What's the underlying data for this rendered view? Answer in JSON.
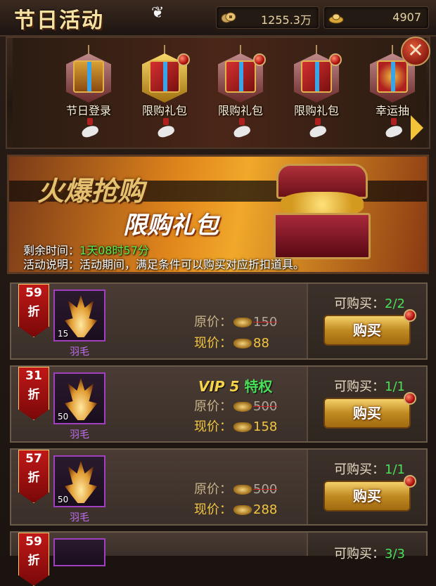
{
  "header": {
    "title": "节日活动",
    "currency_coin": "1255.3万",
    "currency_ingot": "4907"
  },
  "tabs": [
    {
      "label": "节日登录",
      "selected": false,
      "dot": false
    },
    {
      "label": "限购礼包",
      "selected": true,
      "dot": true
    },
    {
      "label": "限购礼包",
      "selected": false,
      "dot": true
    },
    {
      "label": "限购礼包",
      "selected": false,
      "dot": true
    },
    {
      "label": "幸运抽",
      "selected": false,
      "dot": true
    }
  ],
  "banner": {
    "headline": "火爆抢购",
    "subtitle": "限购礼包",
    "remaining_label": "剩余时间：",
    "remaining_value": "1天08时57分",
    "desc_label": "活动说明：",
    "desc_value": "活动期间，满足条件可以购买对应折扣道具。"
  },
  "items": [
    {
      "discount": "59",
      "discount_unit": "折",
      "qty": "15",
      "name": "羽毛",
      "vip": "",
      "orig_label": "原价：",
      "orig": "150",
      "now_label": "现价：",
      "now": "88",
      "can_buy_label": "可购买：",
      "can_buy": "2/2",
      "buy_label": "购买"
    },
    {
      "discount": "31",
      "discount_unit": "折",
      "qty": "50",
      "name": "羽毛",
      "vip": "VIP 5",
      "vip_suffix": "特权",
      "orig_label": "原价：",
      "orig": "500",
      "now_label": "现价：",
      "now": "158",
      "can_buy_label": "可购买：",
      "can_buy": "1/1",
      "buy_label": "购买"
    },
    {
      "discount": "57",
      "discount_unit": "折",
      "qty": "50",
      "name": "羽毛",
      "vip": "",
      "orig_label": "原价：",
      "orig": "500",
      "now_label": "现价：",
      "now": "288",
      "can_buy_label": "可购买：",
      "can_buy": "1/1",
      "buy_label": "购买"
    },
    {
      "discount": "59",
      "discount_unit": "折",
      "can_buy_label": "可购买：",
      "can_buy": "3/3"
    }
  ],
  "colors": {
    "accent_gold": "#f3c640",
    "accent_green": "#4ae05a",
    "badge_red": "#c01818",
    "item_name_purple": "#c070f0"
  },
  "icons": [
    "coin-icon",
    "ingot-icon",
    "butterfly-icon",
    "close-icon",
    "arrow-right-icon",
    "feather-icon",
    "treasure-chest-icon",
    "gift-box-icon"
  ]
}
